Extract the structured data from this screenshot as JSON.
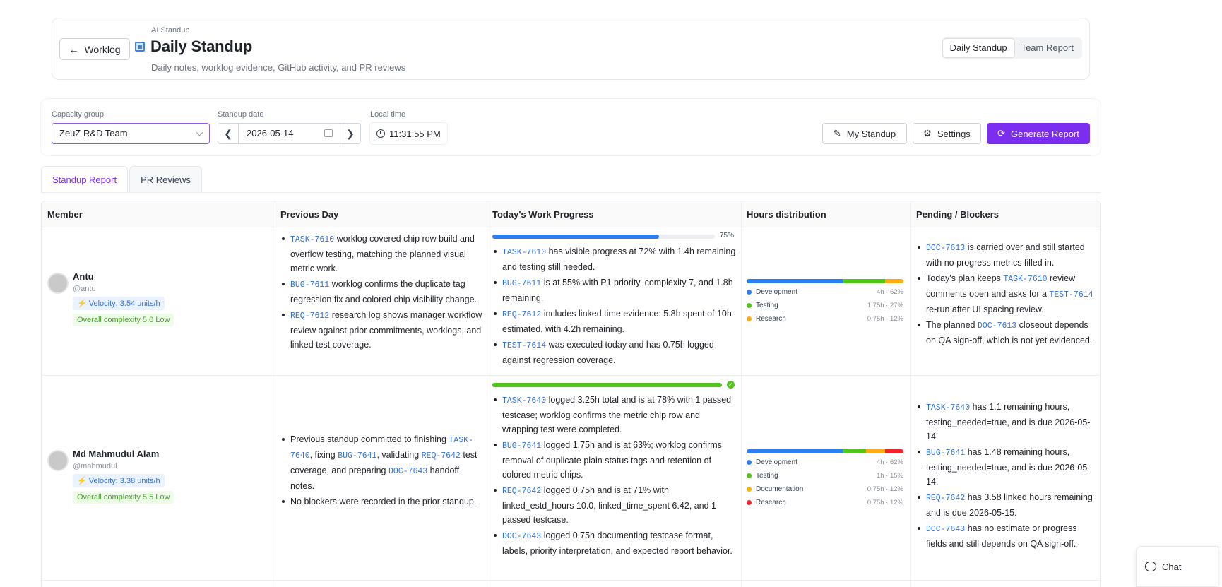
{
  "header": {
    "back_label": "Worklog",
    "eyebrow": "AI Standup",
    "title": "Daily Standup",
    "subtitle": "Daily notes, worklog evidence, GitHub activity, and PR reviews",
    "view_toggle": [
      "Daily Standup",
      "Team Report"
    ],
    "active_view": "Daily Standup"
  },
  "filters": {
    "capacity_label": "Capacity group",
    "capacity_value": "ZeuZ R&D Team",
    "date_label": "Standup date",
    "date_value": "2026-05-14",
    "time_label": "Local time",
    "time_value": "11:31:55 PM",
    "my_standup": "My Standup",
    "settings": "Settings",
    "generate": "Generate Report"
  },
  "tabs": [
    "Standup Report",
    "PR Reviews"
  ],
  "table": {
    "headers": [
      "Member",
      "Previous Day",
      "Today's Work Progress",
      "Hours distribution",
      "Pending / Blockers"
    ],
    "rows": [
      {
        "name": "Antu",
        "handle": "@antu",
        "velocity": "Velocity: 3.54 units/h",
        "complexity": "Overall complexity 5.0 Low",
        "progress_pct": 0.75,
        "progress_label": "75%",
        "progress_done": false,
        "previous": [
          {
            "code": "TASK-7610",
            "text": " worklog covered chip row build and overflow testing, matching the planned visual metric work."
          },
          {
            "code": "BUG-7611",
            "text": " worklog confirms the duplicate tag regression fix and colored chip visibility change."
          },
          {
            "code": "REQ-7612",
            "text": " research log shows manager workflow review against prior commitments, worklogs, and linked test coverage."
          }
        ],
        "today": [
          {
            "code": "TASK-7610",
            "text": " has visible progress at 72% with 1.4h remaining and testing still needed."
          },
          {
            "code": "BUG-7611",
            "text": " is at 55% with P1 priority, complexity 7, and 1.8h remaining."
          },
          {
            "code": "REQ-7612",
            "text": " includes linked time evidence: 5.8h spent of 10h estimated, with 4.2h remaining."
          },
          {
            "code": "TEST-7614",
            "text": " was executed today and has 0.75h logged against regression coverage."
          }
        ],
        "hours": [
          {
            "name": "Development",
            "value": "4h · 62%",
            "color": "#2f7ef0",
            "share": 62
          },
          {
            "name": "Testing",
            "value": "1.75h · 27%",
            "color": "#52c41a",
            "share": 27
          },
          {
            "name": "Research",
            "value": "0.75h · 12%",
            "color": "#faad14",
            "share": 12
          }
        ],
        "pending_html": "<li><span class='code'>DOC-7613</span> is carried over and still started with no progress metrics filled in.</li><li>Today's plan keeps <span class='code'>TASK-7610</span> review comments open and asks for a <span class='code'>TEST-7614</span> re-run after UI spacing review.</li><li>The planned <span class='code'>DOC-7613</span> closeout depends on QA sign-off, which is not yet evidenced.</li>"
      },
      {
        "name": "Md Mahmudul Alam",
        "handle": "@mahmudul",
        "velocity": "Velocity: 3.38 units/h",
        "complexity": "Overall complexity 5.5 Low",
        "progress_pct": 1.0,
        "progress_label": "",
        "progress_done": true,
        "previous_html": "<li>Previous standup committed to finishing <span class='code'>TASK-7640</span>, fixing <span class='code'>BUG-7641</span>, validating <span class='code'>REQ-7642</span> test coverage, and preparing <span class='code'>DOC-7643</span> handoff notes.</li><li>No blockers were recorded in the prior standup.</li>",
        "today": [
          {
            "code": "TASK-7640",
            "text": " logged 3.25h total and is at 78% with 1 passed testcase; worklog confirms the metric chip row and wrapping test were completed."
          },
          {
            "code": "BUG-7641",
            "text": " logged 1.75h and is at 63%; worklog confirms removal of duplicate plain status tags and retention of colored metric chips."
          },
          {
            "code": "REQ-7642",
            "text": " logged 0.75h and is at 71% with linked_estd_hours 10.0, linked_time_spent 6.42, and 1 passed testcase."
          },
          {
            "code": "DOC-7643",
            "text": " logged 0.75h documenting testcase format, labels, priority interpretation, and expected report behavior."
          }
        ],
        "hours": [
          {
            "name": "Development",
            "value": "4h · 62%",
            "color": "#2f7ef0",
            "share": 62
          },
          {
            "name": "Testing",
            "value": "1h · 15%",
            "color": "#52c41a",
            "share": 15
          },
          {
            "name": "Documentation",
            "value": "0.75h · 12%",
            "color": "#faad14",
            "share": 12
          },
          {
            "name": "Research",
            "value": "0.75h · 12%",
            "color": "#f5222d",
            "share": 12
          }
        ],
        "pending_html": "<li><span class='code'>TASK-7640</span> has 1.1 remaining hours, testing_needed=true, and is due 2026-05-14.</li><li><span class='code'>BUG-7641</span> has 1.48 remaining hours, testing_needed=true, and is due 2026-05-14.</li><li><span class='code'>REQ-7642</span> has 3.58 linked hours remaining and is due 2026-05-15.</li><li><span class='code'>DOC-7643</span> has no estimate or progress fields and still depends on QA sign-off.</li>"
      }
    ]
  },
  "chat": {
    "label": "Chat"
  }
}
